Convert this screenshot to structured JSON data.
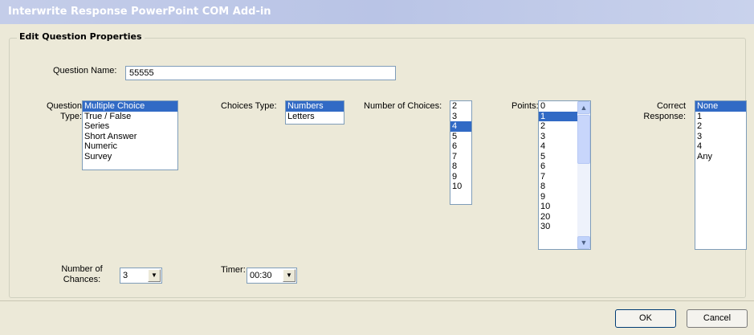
{
  "window": {
    "title": "Interwrite Response PowerPoint COM Add-in"
  },
  "group": {
    "legend": "Edit Question Properties"
  },
  "question_name": {
    "label": "Question Name:",
    "value": "55555"
  },
  "question_type": {
    "label_line1": "Question",
    "label_line2": "Type:",
    "options": [
      "Multiple Choice",
      "True / False",
      "Series",
      "Short Answer",
      "Numeric",
      "Survey"
    ],
    "selected": "Multiple Choice"
  },
  "choices_type": {
    "label": "Choices Type:",
    "options": [
      "Numbers",
      "Letters"
    ],
    "selected": "Numbers"
  },
  "number_of_choices": {
    "label": "Number of Choices:",
    "options": [
      "2",
      "3",
      "4",
      "5",
      "6",
      "7",
      "8",
      "9",
      "10"
    ],
    "selected": "4"
  },
  "points": {
    "label": "Points:",
    "options": [
      "0",
      "1",
      "2",
      "3",
      "4",
      "5",
      "6",
      "7",
      "8",
      "9",
      "10",
      "20",
      "30"
    ],
    "selected": "1",
    "scroll_icons": {
      "up": "scroll-up-arrow-icon",
      "down": "scroll-down-arrow-icon"
    }
  },
  "correct_response": {
    "label_line1": "Correct",
    "label_line2": "Response:",
    "options": [
      "None",
      "1",
      "2",
      "3",
      "4",
      "Any"
    ],
    "selected": "None"
  },
  "number_of_chances": {
    "label_line1": "Number of",
    "label_line2": "Chances:",
    "value": "3"
  },
  "timer": {
    "label": "Timer:",
    "value": "00:30"
  },
  "buttons": {
    "ok": "OK",
    "cancel": "Cancel"
  },
  "colors": {
    "selection": "#316ac5",
    "dialog_background": "#ece9d8",
    "titlebar": "#c4cde9"
  }
}
